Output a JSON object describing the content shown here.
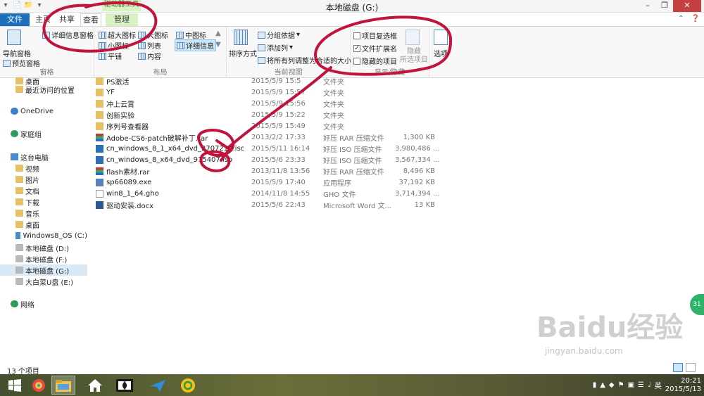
{
  "window": {
    "title": "本地磁盘 (G:)",
    "context_tab_group": "驱动器工具",
    "controls": [
      "minimize-icon",
      "maximize-icon",
      "close-icon"
    ]
  },
  "tabs": [
    {
      "label": "文件"
    },
    {
      "label": "主页"
    },
    {
      "label": "共享"
    },
    {
      "label": "查看"
    },
    {
      "label": "管理"
    }
  ],
  "ribbon": {
    "panes": {
      "label": "窗格",
      "nav_pane": "导航窗格",
      "preview_pane": "预览窗格",
      "details_pane": "详细信息窗格"
    },
    "layout": {
      "label": "布局",
      "items": [
        "超大图标",
        "大图标",
        "中图标",
        "小图标",
        "列表",
        "详细信息",
        "平铺",
        "内容"
      ]
    },
    "current_view": {
      "label": "当前视图",
      "sort_by": "排序方式",
      "group_by": "分组依据",
      "add_column": "添加列",
      "fit_columns": "将所有列调整为合适的大小"
    },
    "show_hide": {
      "label": "显示/隐藏",
      "item_checkboxes": {
        "label": "项目复选框",
        "checked": false
      },
      "file_extensions": {
        "label": "文件扩展名",
        "checked": true
      },
      "hidden_items": {
        "label": "隐藏的项目",
        "checked": false
      },
      "hide_selected": "隐藏\n所选项目",
      "options": "选项"
    }
  },
  "nav": {
    "items": [
      {
        "label": "桌面",
        "icon": "folder"
      },
      {
        "label": "最近访问的位置",
        "icon": "folder"
      },
      {
        "label": "OneDrive",
        "icon": "cloud"
      },
      {
        "label": "家庭组",
        "icon": "net"
      },
      {
        "label": "这台电脑",
        "icon": "pc"
      },
      {
        "label": "视频",
        "icon": "folder"
      },
      {
        "label": "图片",
        "icon": "folder"
      },
      {
        "label": "文档",
        "icon": "folder"
      },
      {
        "label": "下载",
        "icon": "folder"
      },
      {
        "label": "音乐",
        "icon": "folder"
      },
      {
        "label": "桌面",
        "icon": "folder"
      },
      {
        "label": "Windows8_OS (C:)",
        "icon": "pc"
      },
      {
        "label": "本地磁盘 (D:)",
        "icon": "drive"
      },
      {
        "label": "本地磁盘 (F:)",
        "icon": "drive"
      },
      {
        "label": "本地磁盘 (G:)",
        "icon": "drive",
        "selected": true
      },
      {
        "label": "大白菜U盘 (E:)",
        "icon": "drive"
      },
      {
        "label": "网络",
        "icon": "net"
      }
    ]
  },
  "files": [
    {
      "name": "PS激活",
      "date": "2015/5/9 15:5",
      "type": "文件夹",
      "size": "",
      "icon": "folder"
    },
    {
      "name": "YF",
      "date": "2015/5/9 15:57",
      "type": "文件夹",
      "size": "",
      "icon": "folder"
    },
    {
      "name": "冲上云霄",
      "date": "2015/5/9 15:56",
      "type": "文件夹",
      "size": "",
      "icon": "folder"
    },
    {
      "name": "创新实验",
      "date": "2015/5/9 15:22",
      "type": "文件夹",
      "size": "",
      "icon": "folder"
    },
    {
      "name": "序列号查看器",
      "date": "2015/5/9 15:49",
      "type": "文件夹",
      "size": "",
      "icon": "folder"
    },
    {
      "name": "Adobe-CS6-patch破解补丁.rar",
      "date": "2013/2/2 17:33",
      "type": "好压 RAR 压缩文件",
      "size": "1,300 KB",
      "icon": "rar"
    },
    {
      "name": "cn_windows_8_1_x64_dvd_2707217.iso",
      "date": "2015/5/11 16:14",
      "type": "好压 ISO 压缩文件",
      "size": "3,980,486 ...",
      "icon": "iso"
    },
    {
      "name": "cn_windows_8_x64_dvd_915407.iso",
      "date": "2015/5/6 23:33",
      "type": "好压 ISO 压缩文件",
      "size": "3,567,334 ...",
      "icon": "iso"
    },
    {
      "name": "flash素材.rar",
      "date": "2013/11/8 13:56",
      "type": "好压 RAR 压缩文件",
      "size": "8,496 KB",
      "icon": "rar"
    },
    {
      "name": "sp66089.exe",
      "date": "2015/5/9 17:40",
      "type": "应用程序",
      "size": "37,192 KB",
      "icon": "exe"
    },
    {
      "name": "win8_1_64.gho",
      "date": "2014/11/8 14:55",
      "type": "GHO 文件",
      "size": "3,714,394 ...",
      "icon": "gho"
    },
    {
      "name": "驱动安装.docx",
      "date": "2015/5/6 22:43",
      "type": "Microsoft Word 文...",
      "size": "13 KB",
      "icon": "doc"
    }
  ],
  "status": {
    "item_count": "13 个项目"
  },
  "taskbar": {
    "buttons": [
      "windows-start-icon",
      "app-icon",
      "file-explorer-icon",
      "home-icon",
      "dolby-icon",
      "plane-icon",
      "sogou-icon"
    ],
    "clock_time": "20:21",
    "clock_date": "2015/5/13",
    "ime": "英"
  },
  "side_badge": "31",
  "watermark": {
    "brand": "Baidu经验",
    "url": "jingyan.baidu.com"
  },
  "annotation_color": "#c0143c"
}
